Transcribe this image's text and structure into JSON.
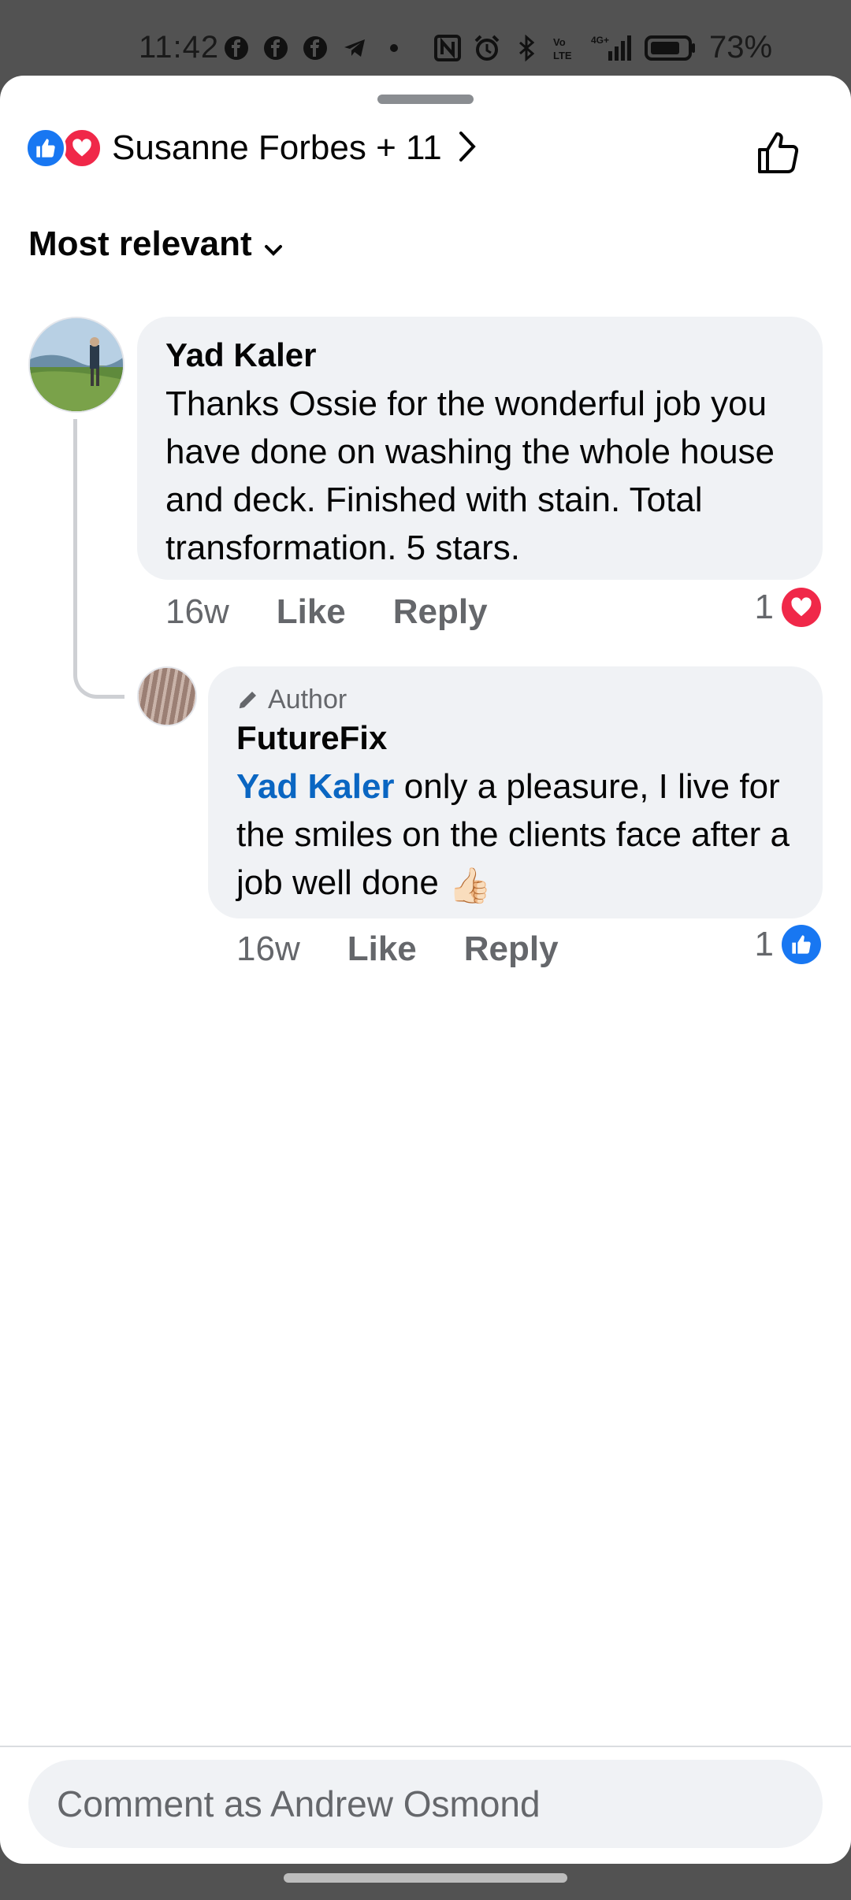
{
  "status_bar": {
    "time": "11:42",
    "network": "4G+",
    "battery": "73%"
  },
  "reactions": {
    "summary": "Susanne Forbes + 11",
    "types": [
      "like-icon",
      "heart-icon"
    ]
  },
  "sort": {
    "label": "Most relevant"
  },
  "comments": [
    {
      "author": "Yad Kaler",
      "text": "Thanks Ossie for the wonderful job you have done on washing the whole house and deck. Finished with stain. Total transformation. 5 stars.",
      "time": "16w",
      "like_label": "Like",
      "reply_label": "Reply",
      "reaction_count": "1",
      "reaction_type": "heart-icon"
    },
    {
      "badge": "Author",
      "author": "FutureFix",
      "mention": "Yad Kaler",
      "text": " only a pleasure, I live for the smiles on the clients face after a job well done ",
      "emoji": "👍🏻",
      "time": "16w",
      "like_label": "Like",
      "reply_label": "Reply",
      "reaction_count": "1",
      "reaction_type": "like-icon"
    }
  ],
  "composer": {
    "placeholder": "Comment as Andrew Osmond"
  },
  "colors": {
    "like_blue": "#1877f2",
    "heart_red": "#f02849",
    "mention_blue": "#0a66c2",
    "bubble_gray": "#f0f2f5"
  }
}
